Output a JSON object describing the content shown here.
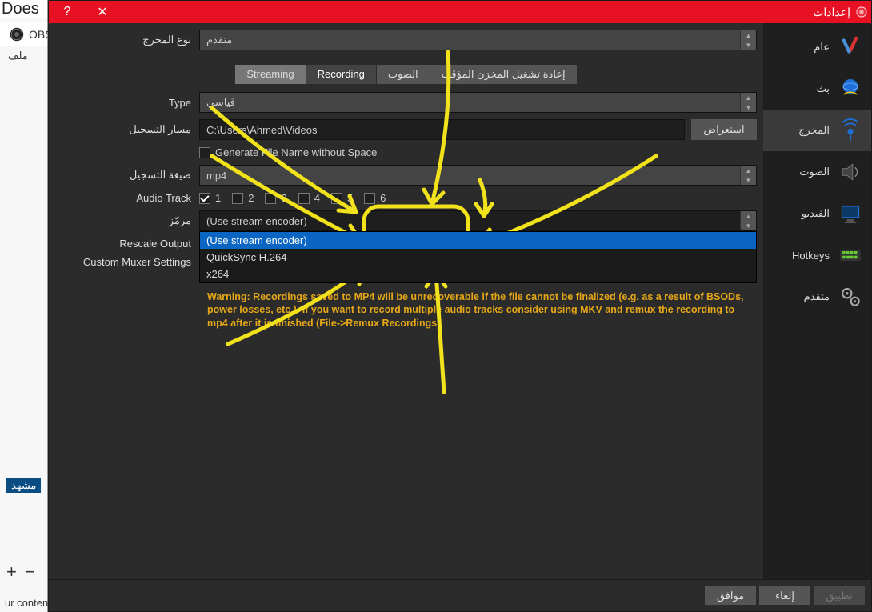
{
  "background": {
    "doc_fragment": "Does",
    "obs_title": "OBS",
    "menu_file": "ملف",
    "scene_label": "مشهد",
    "footer_text": "ur content"
  },
  "dialog": {
    "title": "إعدادات",
    "help": "?",
    "close": "✕"
  },
  "sidebar": {
    "items": [
      {
        "label": "عام"
      },
      {
        "label": "بث"
      },
      {
        "label": "المخرج"
      },
      {
        "label": "الصوت"
      },
      {
        "label": "الفيديو"
      },
      {
        "label": "Hotkeys"
      },
      {
        "label": "متقدم"
      }
    ]
  },
  "output": {
    "mode_label": "نوع المخرج",
    "mode_value": "متقدم"
  },
  "tabs": {
    "streaming": "Streaming",
    "recording": "Recording",
    "audio": "الصوت",
    "replay": "إعادة تشغيل المخزن المؤقت"
  },
  "recording": {
    "type_label": "Type",
    "type_value": "قياسي",
    "path_label": "مسار التسجيل",
    "path_value": "C:\\Users\\Ahmed\\Videos",
    "browse": "استعراض",
    "no_space_label": "Generate File Name without Space",
    "format_label": "صيغة التسجيل",
    "format_value": "mp4",
    "audio_track_label": "Audio Track",
    "tracks": [
      "1",
      "2",
      "3",
      "4",
      "5",
      "6"
    ],
    "encoder_label": "مرمّز",
    "encoder_value": "(Use stream encoder)",
    "encoder_options": [
      "(Use stream encoder)",
      "QuickSync H.264",
      "x264"
    ],
    "rescale_label": "Rescale Output",
    "muxer_label": "Custom Muxer Settings",
    "warning": "Warning: Recordings saved to MP4 will be unrecoverable if the file cannot be finalized (e.g. as a result of BSODs, power losses, etc.). If you want to record multiple audio tracks consider using MKV and remux the recording to mp4 after it is finished (File->Remux Recordings)"
  },
  "footer": {
    "ok": "موافق",
    "cancel": "إلغاء",
    "apply": "تطبيق"
  }
}
